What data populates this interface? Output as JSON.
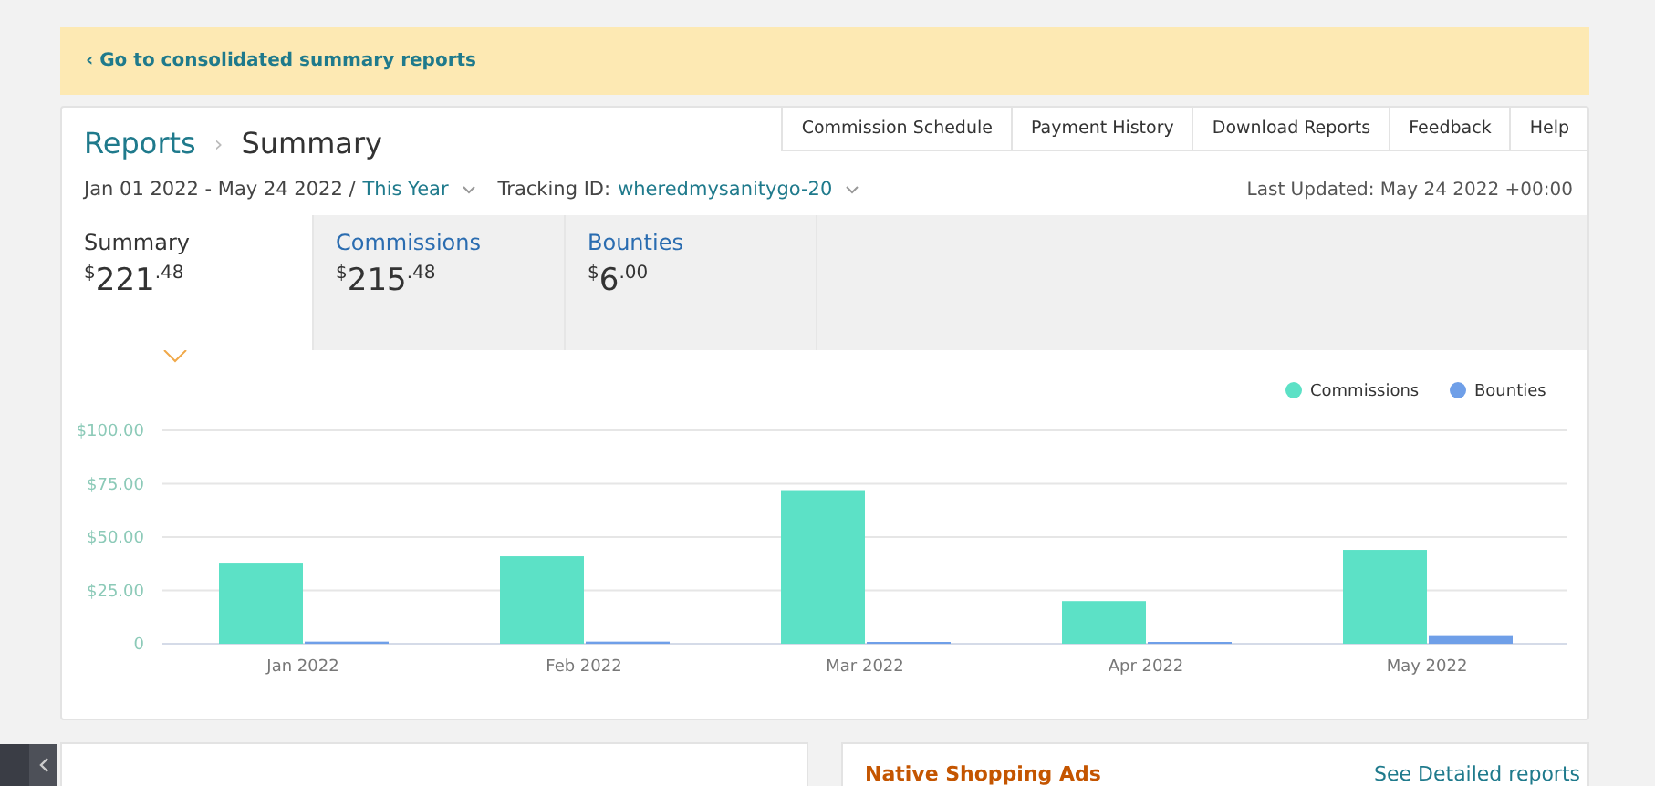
{
  "banner": {
    "link": "‹ Go to consolidated summary reports"
  },
  "breadcrumb": [
    {
      "label": "Reports"
    },
    {
      "label": "Summary"
    }
  ],
  "breadcrumb_separator": "›",
  "top_links": [
    "Commission Schedule",
    "Payment History",
    "Download Reports",
    "Feedback",
    "Help"
  ],
  "filters": {
    "date_range": "Jan 01 2022 - May 24 2022 /",
    "period": "This Year",
    "tracking_label": "Tracking ID:",
    "tracking_id": "wheredmysanitygo-20",
    "last_updated": "Last Updated: May 24 2022 +00:00"
  },
  "tabs": [
    {
      "label": "Summary",
      "currency": "$",
      "whole": "221",
      "cents": ".48",
      "selected": true
    },
    {
      "label": "Commissions",
      "currency": "$",
      "whole": "215",
      "cents": ".48",
      "selected": false
    },
    {
      "label": "Bounties",
      "currency": "$",
      "whole": "6",
      "cents": ".00",
      "selected": false
    }
  ],
  "chart_data": {
    "type": "bar",
    "categories": [
      "Jan 2022",
      "Feb 2022",
      "Mar 2022",
      "Apr 2022",
      "May 2022"
    ],
    "series": [
      {
        "name": "Commissions",
        "color": "#5ce1c6",
        "values": [
          38,
          41,
          72,
          20,
          44
        ]
      },
      {
        "name": "Bounties",
        "color": "#6f9fe8",
        "values": [
          1,
          1,
          0,
          0,
          4
        ]
      }
    ],
    "grid": true,
    "legend": true,
    "ylim": [
      0,
      100
    ],
    "yticks": [
      {
        "value": 0,
        "label": "0"
      },
      {
        "value": 25,
        "label": "$25.00"
      },
      {
        "value": 50,
        "label": "$50.00"
      },
      {
        "value": 75,
        "label": "$75.00"
      },
      {
        "value": 100,
        "label": "$100.00"
      }
    ]
  },
  "panels": [
    {
      "title": "Native Shopping Ads",
      "link": "See Detailed reports"
    }
  ]
}
